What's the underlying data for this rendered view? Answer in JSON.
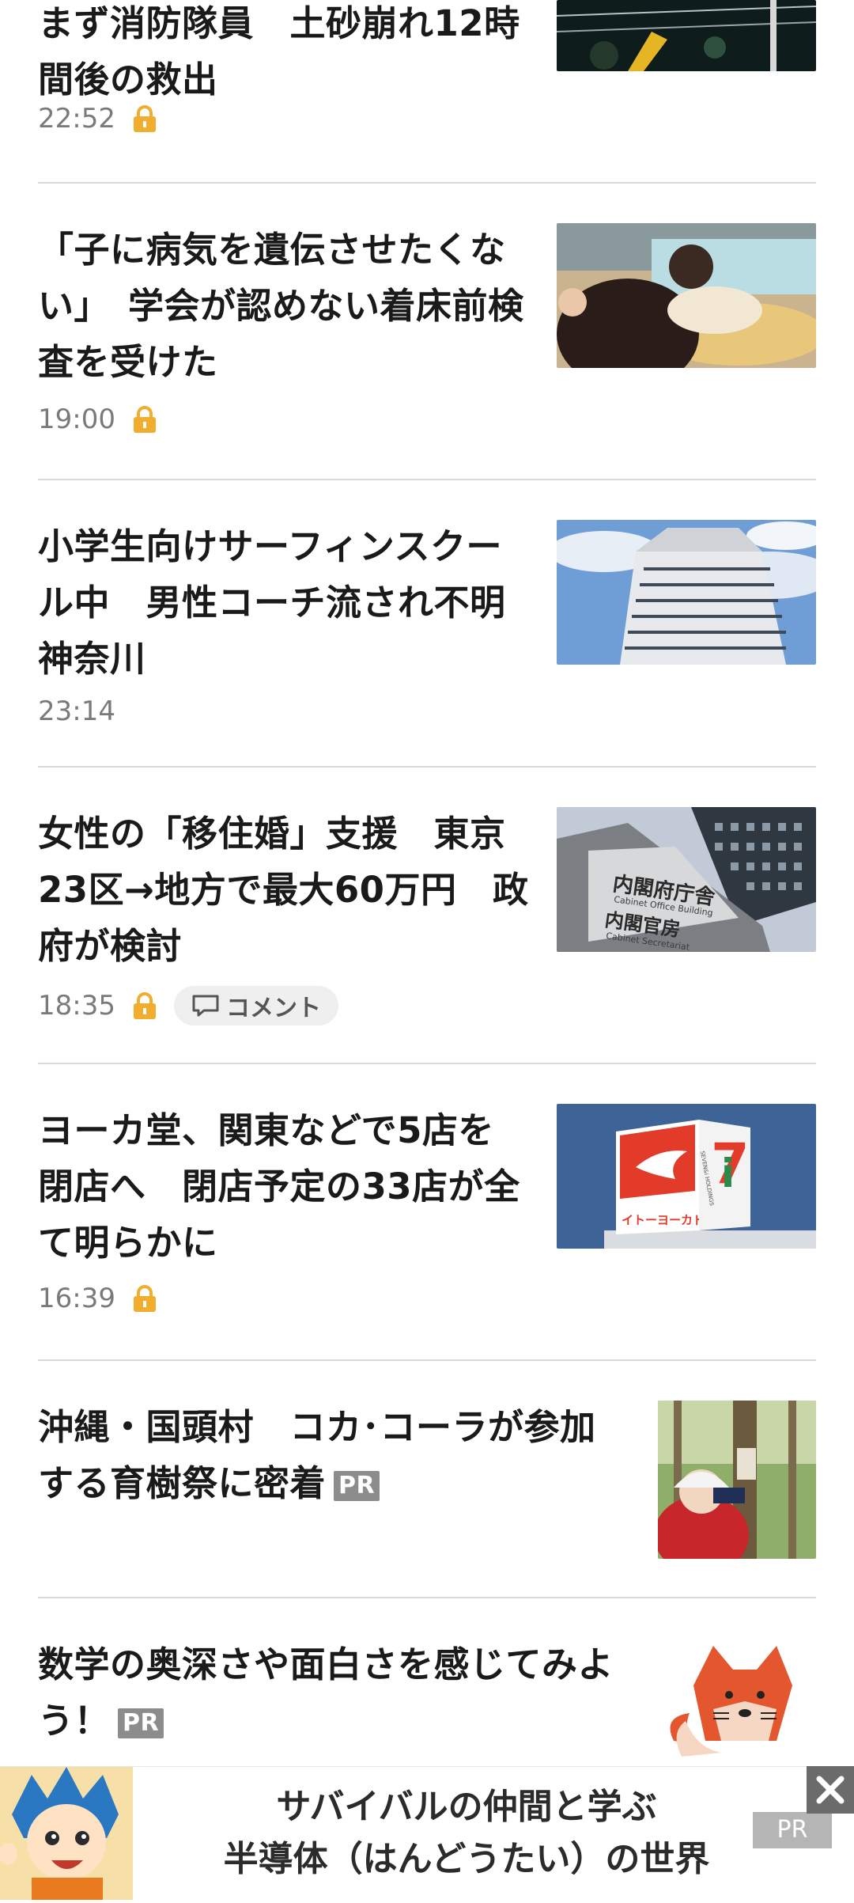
{
  "articles": [
    {
      "title_lines": [
        "まず消防隊員　土砂崩れ12時",
        "間後の救出"
      ],
      "time": "22:52",
      "locked": true
    },
    {
      "title_lines": [
        "「子に病気を遺伝させたくな",
        "い」　学会が認めない着床前検",
        "査を受けた"
      ],
      "time": "19:00",
      "locked": true
    },
    {
      "title_lines": [
        "小学生向けサーフィンスクー",
        "ル中　男性コーチ流され不明",
        "神奈川"
      ],
      "time": "23:14",
      "locked": false
    },
    {
      "title_lines": [
        "女性の「移住婚」支援　東京",
        "23区→地方で最大60万円　政",
        "府が検討"
      ],
      "time": "18:35",
      "locked": true,
      "comment_label": "コメント"
    },
    {
      "title_lines": [
        "ヨーカ堂、関東などで5店を",
        "閉店へ　閉店予定の33店が全",
        "て明らかに"
      ],
      "time": "16:39",
      "locked": true
    },
    {
      "title_lines": [
        "沖縄・国頭村　コカ･コーラが参加",
        "する育樹祭に密着"
      ],
      "pr": "PR"
    },
    {
      "title_lines": [
        "数学の奥深さや面白さを感じてみよ",
        "う！"
      ],
      "pr": "PR"
    }
  ],
  "thumb_text": {
    "cabinet1": "内閣府庁舎",
    "cabinet1_en": "Cabinet Office Building",
    "cabinet2": "内閣官房",
    "cabinet2_en": "Cabinet Secretariat",
    "yokado": "イトーヨーカドー",
    "seven": "SEVEN&i HOLDINGS"
  },
  "ad": {
    "line1": "サバイバルの仲間と学ぶ",
    "line2": "半導体（はんどうたい）の世界",
    "pr": "PR",
    "close": "✕"
  },
  "colors": {
    "lock": "#f0ad2e",
    "divider": "#d9d9d9",
    "text": "#1a1a1a",
    "meta": "#7a7a7a"
  }
}
